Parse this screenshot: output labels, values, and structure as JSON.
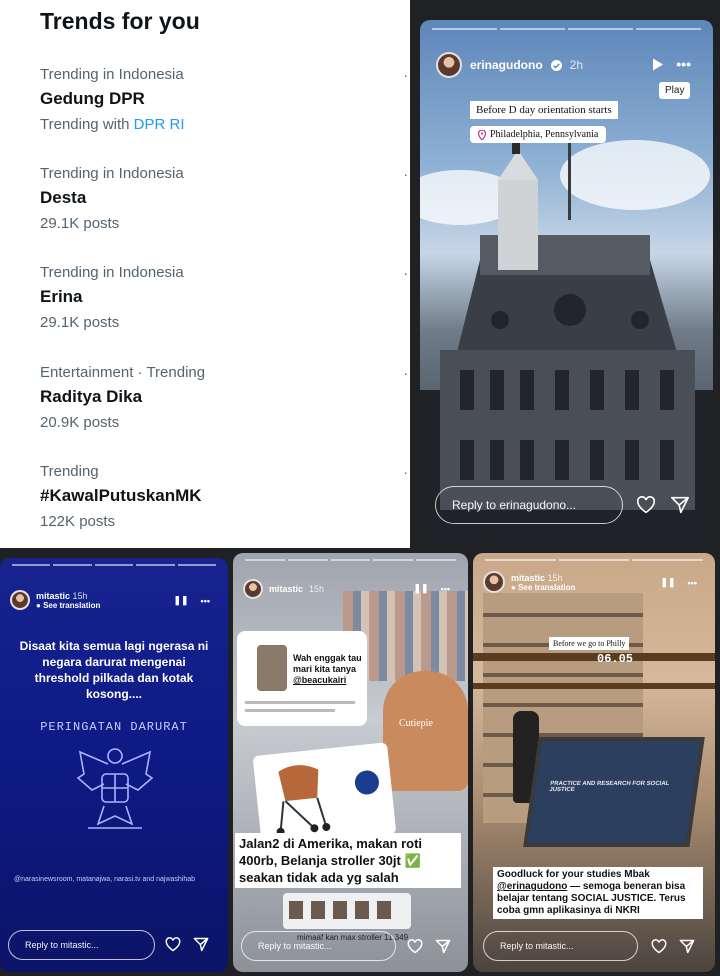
{
  "trends": {
    "title": "Trends for you",
    "items": [
      {
        "meta": "Trending in Indonesia",
        "name": "Gedung DPR",
        "sub_prefix": "Trending with",
        "sub_link": "DPR RI",
        "posts": ""
      },
      {
        "meta": "Trending in Indonesia",
        "name": "Desta",
        "posts": "29.1K posts"
      },
      {
        "meta": "Trending in Indonesia",
        "name": "Erina",
        "posts": "29.1K posts"
      },
      {
        "meta": "Entertainment · Trending",
        "name": "Raditya Dika",
        "posts": "20.9K posts"
      },
      {
        "meta": "Trending",
        "name": "#KawalPutuskanMK",
        "posts": "122K posts"
      }
    ],
    "more_glyph": "·"
  },
  "story1": {
    "username": "erinagudono",
    "time": "2h",
    "play_tooltip": "Play",
    "caption": "Before D day orientation starts",
    "location": "Philadelphia, Pennsylvania",
    "reply_placeholder": "Reply to erinagudono...",
    "more_glyph": "•••"
  },
  "story2": {
    "username": "mitastic",
    "time": "15h",
    "see_translation": "See translation",
    "text": "Disaat kita semua lagi ngerasa ni negara darurat mengenai threshold pilkada dan kotak kosong....",
    "warning": "PERINGATAN DARURAT",
    "credit": "@narasinewsroom, matanajwa, narasi.tv and najwashihab",
    "reply_placeholder": "Reply to mitastic...",
    "pause_glyph": "❚❚",
    "more_glyph": "•••"
  },
  "story3": {
    "username": "mitastic",
    "time": "15h",
    "chat_text": "Wah enggak tau mari kita tanya",
    "chat_mention": "@beacukairi",
    "sticker": "Cutiepie",
    "caption": "Jalan2 di Amerika, makan roti 400rb, Belanja stroller 30jt ✅ seakan tidak ada yg salah",
    "footer_text": "mimaaf kan max stroller",
    "footer_price": "11.349",
    "reply_placeholder": "Reply to mitastic...",
    "pause_glyph": "❚❚",
    "more_glyph": "•••"
  },
  "story4": {
    "username": "mitastic",
    "time": "15h",
    "see_translation": "See translation",
    "note": "Before we go to Philly",
    "clock": "06.05",
    "caption_prefix": "Goodluck for your studies Mbak",
    "mention": "@erinagudono",
    "caption_suffix": "— semoga beneran bisa belajar tentang SOCIAL JUSTICE. Terus coba gmn aplikasinya di NKRI",
    "laptop_text": "PRACTICE AND RESEARCH FOR SOCIAL JUSTICE",
    "reply_placeholder": "Reply to mitastic...",
    "pause_glyph": "❚❚",
    "more_glyph": "•••"
  }
}
